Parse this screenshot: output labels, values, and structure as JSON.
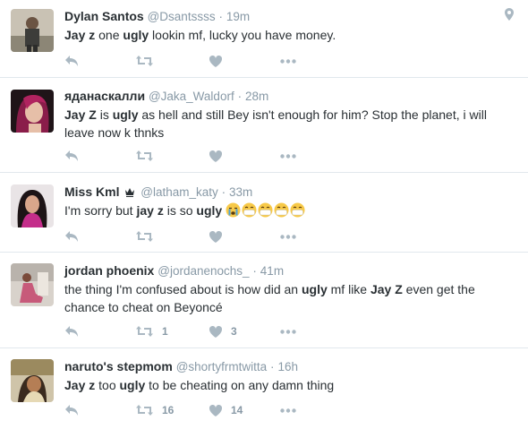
{
  "tweets": [
    {
      "name": "Dylan Santos",
      "handle": "@Dsantssss",
      "separator": "·",
      "time": "19m",
      "segments": [
        {
          "t": "Jay z",
          "b": true
        },
        {
          "t": " one ",
          "b": false
        },
        {
          "t": "ugly",
          "b": true
        },
        {
          "t": " lookin mf, lucky you have money.",
          "b": false
        }
      ],
      "retweets": "",
      "likes": ""
    },
    {
      "name": "яданаскалли",
      "handle": "@Jaka_Waldorf",
      "separator": "·",
      "time": "28m",
      "segments": [
        {
          "t": "Jay Z",
          "b": true
        },
        {
          "t": " is ",
          "b": false
        },
        {
          "t": "ugly",
          "b": true
        },
        {
          "t": " as hell and still Bey isn't enough for him? Stop the planet, i will leave now k thnks",
          "b": false
        }
      ],
      "retweets": "",
      "likes": ""
    },
    {
      "name": "Miss Kml",
      "handle": "@latham_katy",
      "separator": "·",
      "time": "33m",
      "segments": [
        {
          "t": "I'm sorry but ",
          "b": false
        },
        {
          "t": "jay z",
          "b": true
        },
        {
          "t": " is so ",
          "b": false
        },
        {
          "t": "ugly",
          "b": true
        },
        {
          "t": " ",
          "b": false
        }
      ],
      "retweets": "",
      "likes": ""
    },
    {
      "name": "jordan phoenix",
      "handle": "@jordanenochs_",
      "separator": "·",
      "time": "41m",
      "segments": [
        {
          "t": "the thing I'm confused about is how did an ",
          "b": false
        },
        {
          "t": "ugly",
          "b": true
        },
        {
          "t": " mf like ",
          "b": false
        },
        {
          "t": "Jay Z",
          "b": true
        },
        {
          "t": " even get the chance to cheat on Beyoncé",
          "b": false
        }
      ],
      "retweets": "1",
      "likes": "3"
    },
    {
      "name": "naruto's stepmom",
      "handle": "@shortyfrmtwitta",
      "separator": "·",
      "time": "16h",
      "segments": [
        {
          "t": "Jay z",
          "b": true
        },
        {
          "t": " too ",
          "b": false
        },
        {
          "t": "ugly",
          "b": true
        },
        {
          "t": " to be cheating on any damn thing",
          "b": false
        }
      ],
      "retweets": "16",
      "likes": "14"
    }
  ],
  "colors": {
    "name": "#292f33",
    "meta": "#8899a6",
    "icon": "#aab8c2",
    "divider": "#e1e8ed"
  },
  "icons": [
    "reply-icon",
    "retweet-icon",
    "like-icon",
    "more-icon",
    "location-pin-icon",
    "crown-icon",
    "crying-emoji",
    "mask-emoji"
  ]
}
